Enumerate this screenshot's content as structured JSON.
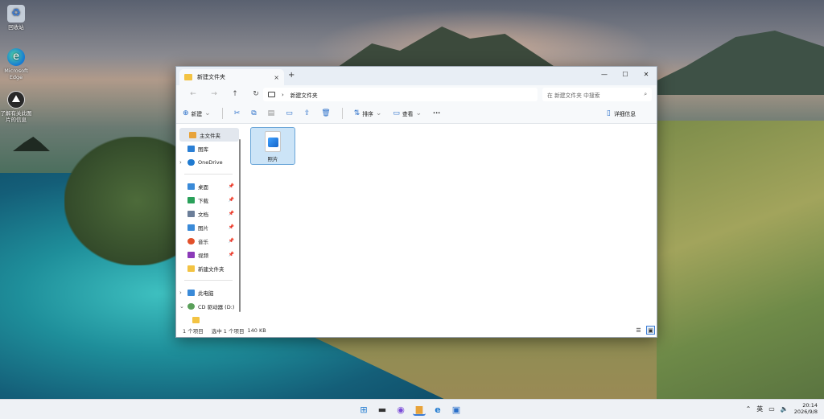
{
  "desktop": {
    "icons": [
      {
        "label": "回收站",
        "glyph": "♻"
      },
      {
        "label": "Microsoft Edge",
        "glyph": "e"
      },
      {
        "label": "了解有关此图片的信息",
        "glyph": "⛰"
      }
    ]
  },
  "window": {
    "tab_title": "新建文件夹",
    "tab_close": "×",
    "new_tab": "+",
    "controls": {
      "minimize": "—",
      "maximize": "☐",
      "close": "✕"
    },
    "nav": {
      "back": "←",
      "forward": "→",
      "up": "↑",
      "refresh": "↻"
    },
    "address": {
      "separator": "›",
      "path": "新建文件夹"
    },
    "search": {
      "placeholder": "在 新建文件夹 中搜索",
      "icon": "⌕"
    },
    "commands": {
      "new_label": "新建",
      "sort_label": "排序",
      "view_label": "查看",
      "more": "···",
      "details_label": "详细信息"
    },
    "nav_pane": {
      "items": [
        {
          "label": "主文件夹",
          "color": "#e8a33a"
        },
        {
          "label": "图库",
          "color": "#2a7fd5"
        },
        {
          "label": "OneDrive",
          "color": "#1f7ad0"
        }
      ],
      "quick": [
        {
          "label": "桌面",
          "color": "#3a8ad8"
        },
        {
          "label": "下载",
          "color": "#2aa05a"
        },
        {
          "label": "文档",
          "color": "#6b7e99"
        },
        {
          "label": "图片",
          "color": "#3a8ad8"
        },
        {
          "label": "音乐",
          "color": "#e2502a"
        },
        {
          "label": "视频",
          "color": "#8b3ab8"
        },
        {
          "label": "新建文件夹",
          "color": "#f3c343"
        }
      ],
      "devices": [
        {
          "label": "此电脑",
          "color": "#3a8ad8"
        },
        {
          "label": "CD 驱动器 (D:)",
          "color": "#5aa05a"
        }
      ]
    },
    "files": [
      {
        "name": "照片"
      }
    ],
    "status": {
      "count": "1 个项目",
      "selected": "选中 1 个项目",
      "size": "140 KB"
    }
  },
  "taskbar": {
    "apps": [
      "⊞",
      "▬",
      "◉",
      "▆",
      "e",
      "▣"
    ],
    "tray_chevron": "⌃",
    "ime": "英",
    "time": "20:14",
    "date": "2026/9/8"
  }
}
